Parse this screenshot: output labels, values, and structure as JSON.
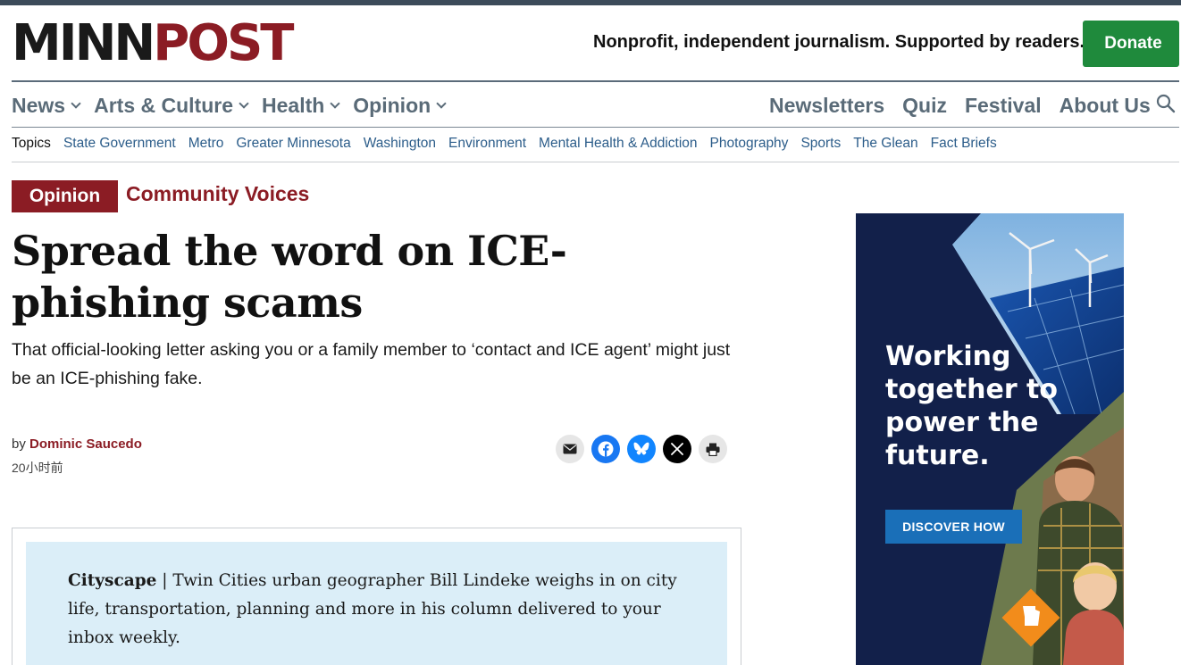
{
  "header": {
    "logo_part1": "MINN",
    "logo_part2": "POST",
    "tagline": "Nonprofit, independent journalism. Supported by readers.",
    "donate_label": "Donate"
  },
  "nav": {
    "main": [
      "News",
      "Arts & Culture",
      "Health",
      "Opinion"
    ],
    "right": [
      "Newsletters",
      "Quiz",
      "Festival",
      "About Us"
    ]
  },
  "topics": {
    "label": "Topics",
    "items": [
      "State Government",
      "Metro",
      "Greater Minnesota",
      "Washington",
      "Environment",
      "Mental Health & Addiction",
      "Photography",
      "Sports",
      "The Glean",
      "Fact Briefs"
    ]
  },
  "article": {
    "badge": "Opinion",
    "section": "Community Voices",
    "headline": "Spread the word on ICE-phishing scams",
    "dek": "That official-looking letter asking you or a family member to ‘contact and ICE agent’ might just be an ICE-phishing fake.",
    "by": "by",
    "author": "Dominic Saucedo",
    "time": "20小时前"
  },
  "share": [
    "email-icon",
    "facebook-icon",
    "bluesky-icon",
    "x-icon",
    "print-icon"
  ],
  "promo": {
    "name": "Cityscape",
    "separator": " | ",
    "text": "Twin Cities urban geographer Bill Lindeke weighs in on city life, transportation, planning and more in his column delivered to your inbox weekly."
  },
  "ad": {
    "title": "Working together to power the future.",
    "button": "DISCOVER HOW"
  },
  "colors": {
    "brand_red": "#8b1c24",
    "nav_gray": "#5a6b78",
    "link_blue": "#2c5d8a",
    "donate_green": "#1f8a3c",
    "promo_bg": "#dbeef8",
    "ad_bg": "#12204a"
  }
}
